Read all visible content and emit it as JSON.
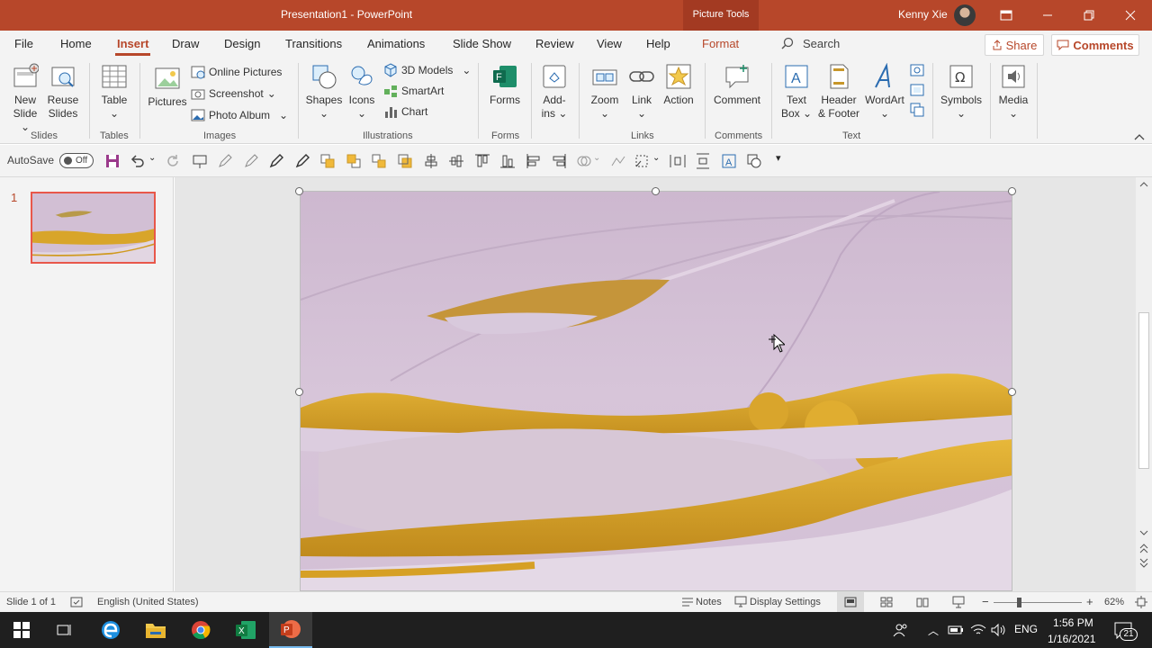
{
  "titlebar": {
    "title": "Presentation1  -  PowerPoint",
    "context_tab": "Picture Tools",
    "user": "Kenny Xie"
  },
  "tabs": {
    "file": "File",
    "home": "Home",
    "insert": "Insert",
    "draw": "Draw",
    "design": "Design",
    "transitions": "Transitions",
    "animations": "Animations",
    "slideshow": "Slide Show",
    "review": "Review",
    "view": "View",
    "help": "Help",
    "format": "Format",
    "search": "Search",
    "share": "Share",
    "comments": "Comments"
  },
  "ribbon": {
    "new_slide": [
      "New",
      "Slide"
    ],
    "reuse_slides": [
      "Reuse",
      "Slides"
    ],
    "table": "Table",
    "pictures": "Pictures",
    "online_pictures": "Online Pictures",
    "screenshot": "Screenshot",
    "photo_album": "Photo Album",
    "shapes": "Shapes",
    "icons": "Icons",
    "models_3d": "3D Models",
    "smartart": "SmartArt",
    "chart": "Chart",
    "forms": "Forms",
    "addins": [
      "Add-",
      "ins"
    ],
    "zoom": "Zoom",
    "link": "Link",
    "action": "Action",
    "comment": "Comment",
    "text_box": [
      "Text",
      "Box"
    ],
    "header_footer": [
      "Header",
      "& Footer"
    ],
    "wordart": "WordArt",
    "symbols": "Symbols",
    "media": "Media",
    "groups": {
      "slides": "Slides",
      "tables": "Tables",
      "images": "Images",
      "illustrations": "Illustrations",
      "forms": "Forms",
      "links": "Links",
      "comments": "Comments",
      "text": "Text"
    }
  },
  "qat": {
    "autosave": "AutoSave",
    "toggle": "Off"
  },
  "slides": {
    "number": "1"
  },
  "status": {
    "slide_of": "Slide 1 of 1",
    "language": "English (United States)",
    "notes": "Notes",
    "display_settings": "Display Settings",
    "zoom": "62%"
  },
  "taskbar": {
    "lang": "ENG",
    "time": "1:56 PM",
    "date": "1/16/2021",
    "notifications": "21"
  },
  "colors": {
    "accent": "#b7472a",
    "selection": "#e8574a"
  }
}
